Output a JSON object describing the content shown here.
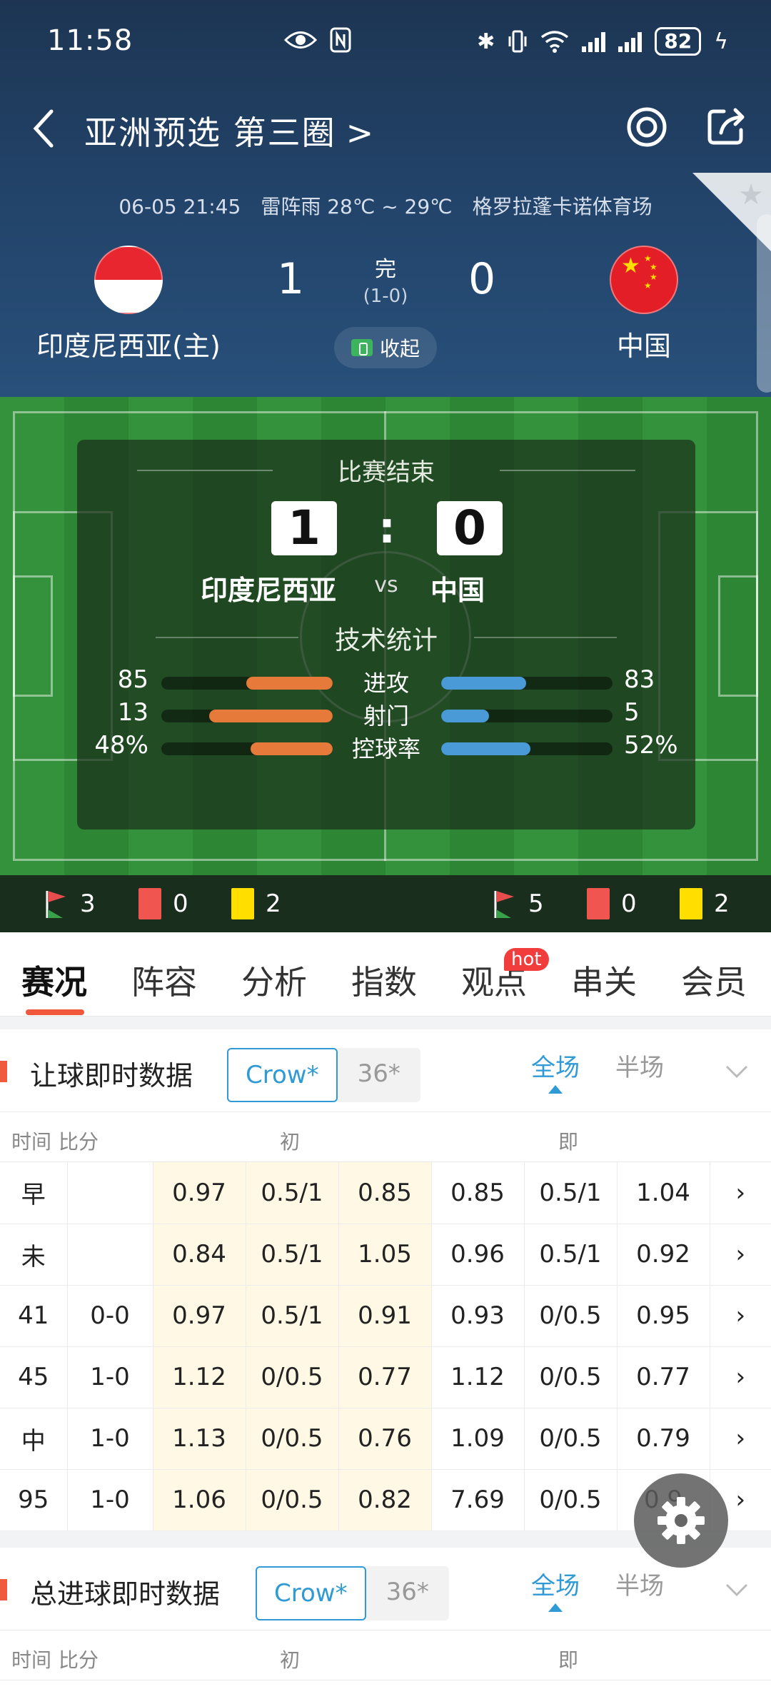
{
  "status_bar": {
    "time": "11:58",
    "battery": "82"
  },
  "nav": {
    "title": "亚洲预选 第三圈",
    "arrow": ">"
  },
  "match_info": {
    "datetime": "06-05 21:45",
    "weather": "雷阵雨 28℃ ~ 29℃",
    "venue": "格罗拉蓬卡诺体育场"
  },
  "home": {
    "name": "印度尼西亚(主)",
    "short": "印度尼西亚",
    "score": "1"
  },
  "away": {
    "name": "中国",
    "short": "中国",
    "score": "0"
  },
  "status": {
    "done": "完",
    "half": "(1-0)",
    "collapse": "收起"
  },
  "panel": {
    "title": "比赛结束",
    "colon": ":",
    "vs": "vs",
    "tech_title": "技术统计",
    "stats": [
      {
        "label": "进攻",
        "home": "85",
        "away": "83",
        "home_ratio": 0.506,
        "away_ratio": 0.494
      },
      {
        "label": "射门",
        "home": "13",
        "away": "5",
        "home_ratio": 0.722,
        "away_ratio": 0.278
      },
      {
        "label": "控球率",
        "home": "48%",
        "away": "52%",
        "home_ratio": 0.48,
        "away_ratio": 0.52
      }
    ]
  },
  "events": {
    "home": {
      "corners": "3",
      "red": "0",
      "yellow": "2"
    },
    "away": {
      "corners": "5",
      "red": "0",
      "yellow": "2"
    }
  },
  "tabs": [
    "赛况",
    "阵容",
    "分析",
    "指数",
    "观点",
    "串关",
    "会员"
  ],
  "hot_badge": "hot",
  "handicap": {
    "title": "让球即时数据",
    "book_selected": "Crow*",
    "book_other": "36*",
    "full": "全场",
    "half": "半场",
    "cols": {
      "time": "时间",
      "score": "比分",
      "initial": "初",
      "live": "即"
    },
    "rows": [
      {
        "time": "早",
        "score": "",
        "i1": "0.97",
        "i2": "0.5/1",
        "i3": "0.85",
        "l1": "0.85",
        "l2": "0.5/1",
        "l3": "1.04"
      },
      {
        "time": "未",
        "score": "",
        "i1": "0.84",
        "i2": "0.5/1",
        "i3": "1.05",
        "l1": "0.96",
        "l2": "0.5/1",
        "l3": "0.92"
      },
      {
        "time": "41",
        "score": "0-0",
        "i1": "0.97",
        "i2": "0.5/1",
        "i3": "0.91",
        "l1": "0.93",
        "l2": "0/0.5",
        "l3": "0.95"
      },
      {
        "time": "45",
        "score": "1-0",
        "i1": "1.12",
        "i2": "0/0.5",
        "i3": "0.77",
        "l1": "1.12",
        "l2": "0/0.5",
        "l3": "0.77"
      },
      {
        "time": "中",
        "score": "1-0",
        "i1": "1.13",
        "i2": "0/0.5",
        "i3": "0.76",
        "l1": "1.09",
        "l2": "0/0.5",
        "l3": "0.79"
      },
      {
        "time": "95",
        "score": "1-0",
        "i1": "1.06",
        "i2": "0/0.5",
        "i3": "0.82",
        "l1": "7.69",
        "l2": "0/0.5",
        "l3": "0.9"
      }
    ]
  },
  "totals": {
    "title": "总进球即时数据",
    "book_selected": "Crow*",
    "book_other": "36*",
    "full": "全场",
    "half": "半场",
    "cols": {
      "time": "时间",
      "score": "比分",
      "initial": "初",
      "live": "即"
    }
  }
}
